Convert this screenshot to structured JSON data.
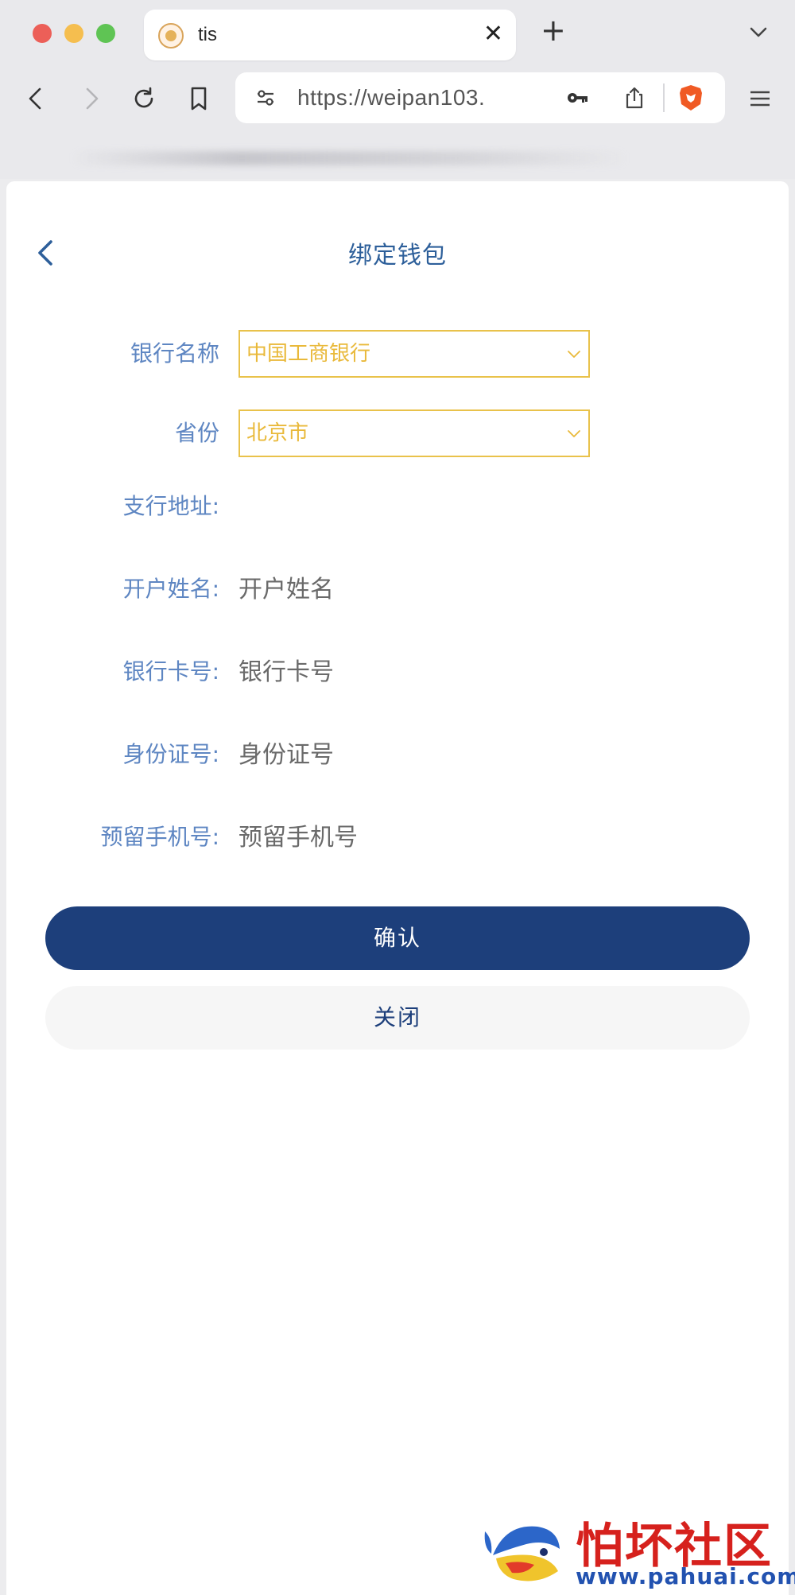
{
  "browser": {
    "tab_title": "tis",
    "url": "https://weipan103.",
    "icons": [
      "close-icon",
      "plus-icon",
      "chevron-down-icon",
      "back-icon",
      "forward-icon",
      "reload-icon",
      "bookmark-icon",
      "site-settings-icon",
      "key-icon",
      "share-icon",
      "brave-shield-icon",
      "menu-icon"
    ]
  },
  "page": {
    "title": "绑定钱包"
  },
  "form": {
    "bank_name": {
      "label": "银行名称",
      "value": "中国工商银行"
    },
    "province": {
      "label": "省份",
      "value": "北京市"
    },
    "branch": {
      "label": "支行地址:",
      "placeholder": ""
    },
    "account_name": {
      "label": "开户姓名:",
      "placeholder": "开户姓名"
    },
    "card_number": {
      "label": "银行卡号:",
      "placeholder": "银行卡号"
    },
    "id_number": {
      "label": "身份证号:",
      "placeholder": "身份证号"
    },
    "phone": {
      "label": "预留手机号:",
      "placeholder": "预留手机号"
    }
  },
  "buttons": {
    "confirm": "确认",
    "close": "关闭"
  },
  "watermark": {
    "name": "怕坏社区",
    "url": "www.pahuai.com"
  },
  "colors": {
    "primary": "#1d3f7b",
    "label": "#5e86c2",
    "select_accent": "#e9c24b"
  }
}
